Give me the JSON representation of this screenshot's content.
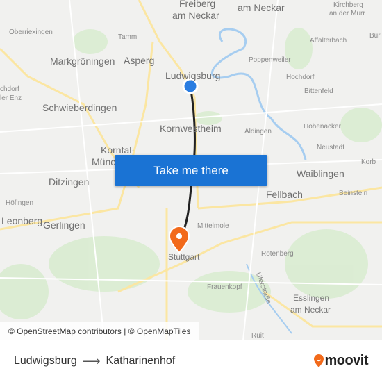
{
  "map": {
    "labels": [
      "Freiberg",
      "am Neckar",
      "am Neckar",
      "Kirchberg",
      "an der Murr",
      "Oberriexingen",
      "Tamm",
      "Affalterbach",
      "Markgröningen",
      "Asperg",
      "Ludwigsburg",
      "Poppenweiler",
      "Hochdorf",
      "Bittenfeld",
      "Schwieberdingen",
      "Kornwestheim",
      "Aldingen",
      "Hohenacker",
      "Korntal-",
      "Münchingen",
      "Neustadt",
      "Ditzingen",
      "Waiblingen",
      "Korb",
      "Fellbach",
      "Beinstein",
      "Höfingen",
      "Leonberg",
      "Gerlingen",
      "Mittelmole",
      "Stuttgart",
      "Rotenberg",
      "Uferstraße",
      "Frauenkopf",
      "Esslingen",
      "am Neckar",
      "Ruit",
      "Bur",
      "chdorf",
      "ler Enz"
    ],
    "origin_color": "#2a7de1",
    "destination_color": "#f26a1b",
    "route_color": "#222222"
  },
  "cta": {
    "label": "Take me there"
  },
  "attribution": "© OpenStreetMap contributors | © OpenMapTiles",
  "footer": {
    "from": "Ludwigsburg",
    "arrow": "⟶",
    "to": "Katharinenhof",
    "logo": "moovit",
    "logo_color": "#f26a1b"
  }
}
